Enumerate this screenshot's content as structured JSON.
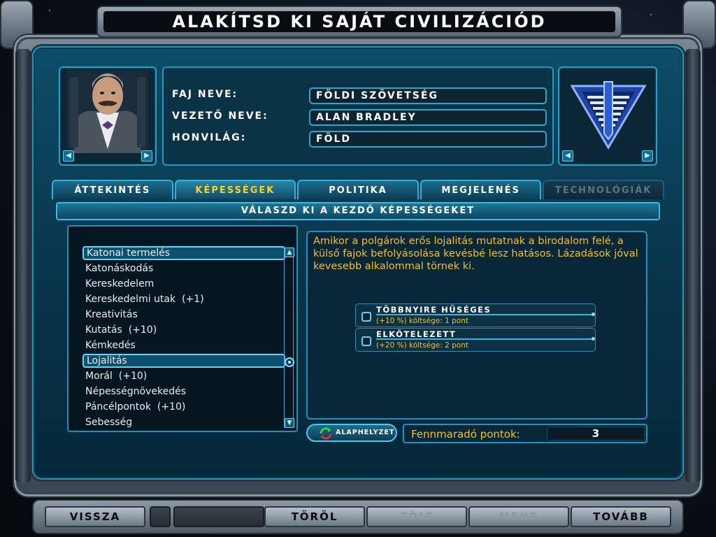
{
  "window": {
    "title": "ALAKÍTSD KI SAJÁT CIVILIZÁCIÓD"
  },
  "race_info": {
    "race_name_label": "Faj neve:",
    "race_name_value": "Földi szövetség",
    "leader_name_label": "Vezető neve:",
    "leader_name_value": "Alan Bradley",
    "homeworld_label": "Honvilág:",
    "homeworld_value": "Föld"
  },
  "tabs": [
    {
      "label": "Áttekintés",
      "state": "normal"
    },
    {
      "label": "Képességek",
      "state": "active"
    },
    {
      "label": "Politika",
      "state": "normal"
    },
    {
      "label": "Megjelenés",
      "state": "normal"
    },
    {
      "label": "Technológiák",
      "state": "disabled"
    }
  ],
  "section_header": "Válaszd ki a kezdő képességeket",
  "abilities": [
    "Katonai termelés",
    "Katonáskodás",
    "Kereskedelem",
    "Kereskedelmi utak  (+1)",
    "Kreativitás",
    "Kutatás  (+10)",
    "Kémkedés",
    "Lojalitás",
    "Morál  (+10)",
    "Népességnövekedés",
    "Páncélpontok  (+10)",
    "Sebesség"
  ],
  "selected_ability": "Lojalitás",
  "description": "Amikor a polgárok erős lojalitás mutatnak a birodalom felé, a külső fajok befolyásolása kevésbé lesz hatásos. Lázadások jóval kevesebb alkalommal törnek ki.",
  "options": [
    {
      "title": "Többnyire hűséges",
      "cost": "(+10 %) költsége: 1 pont",
      "checked": false
    },
    {
      "title": "Elkötelezett",
      "cost": "(+20 %) költsége: 2 pont",
      "checked": false
    }
  ],
  "reset_button": "Alaphelyzet",
  "remaining_points_label": "Fennmaradó pontok:",
  "remaining_points_value": "3",
  "nav": {
    "back": "Vissza",
    "delete": "Töröl",
    "load": "Tölt",
    "save": "Ment",
    "next": "Tovább"
  },
  "icons": {
    "portrait": "leader-portrait",
    "emblem": "race-emblem",
    "arrow_left": "◀",
    "arrow_right": "▶",
    "scroll_up": "▲",
    "scroll_down": "▼"
  },
  "colors": {
    "accent": "#2eb3dc",
    "highlight_text": "#f3c120",
    "active_tab": "#ffd21a"
  }
}
